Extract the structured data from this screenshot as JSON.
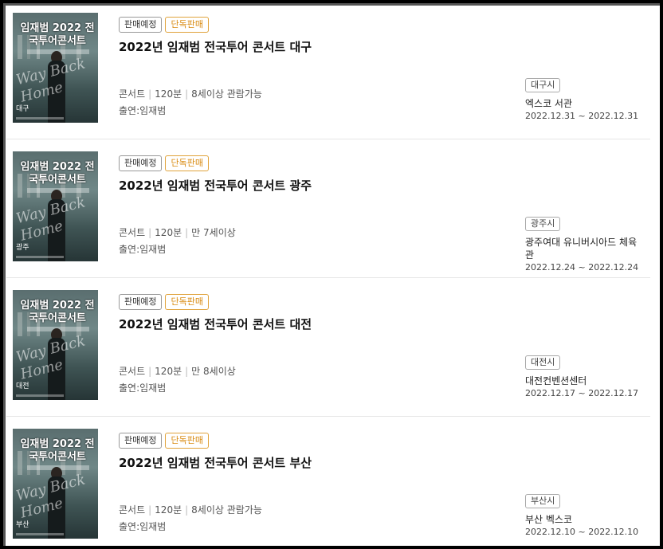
{
  "items": [
    {
      "badge1": "판매예정",
      "badge2": "단독판매",
      "title": "2022년 임재범 전국투어 콘서트 대구",
      "genre": "콘서트",
      "runtime": "120분",
      "age": "8세이상 관람가능",
      "cast": "출연:임재범",
      "region": "대구시",
      "venue": "엑스코 서관",
      "dates": "2022.12.31 ~ 2022.12.31",
      "poster_title": "임재범 2022 전국투어콘서트",
      "poster_script": "Way Back Home",
      "poster_city": "대구"
    },
    {
      "badge1": "판매예정",
      "badge2": "단독판매",
      "title": "2022년 임재범 전국투어 콘서트 광주",
      "genre": "콘서트",
      "runtime": "120분",
      "age": "만 7세이상",
      "cast": "출연:임재범",
      "region": "광주시",
      "venue": "광주여대 유니버시아드 체육관",
      "dates": "2022.12.24 ~ 2022.12.24",
      "poster_title": "임재범 2022 전국투어콘서트",
      "poster_script": "Way Back Home",
      "poster_city": "광주"
    },
    {
      "badge1": "판매예정",
      "badge2": "단독판매",
      "title": "2022년 임재범 전국투어 콘서트 대전",
      "genre": "콘서트",
      "runtime": "120분",
      "age": "만 8세이상",
      "cast": "출연:임재범",
      "region": "대전시",
      "venue": "대전컨벤션센터",
      "dates": "2022.12.17 ~ 2022.12.17",
      "poster_title": "임재범 2022 전국투어콘서트",
      "poster_script": "Way Back Home",
      "poster_city": "대전"
    },
    {
      "badge1": "판매예정",
      "badge2": "단독판매",
      "title": "2022년 임재범 전국투어 콘서트 부산",
      "genre": "콘서트",
      "runtime": "120분",
      "age": "8세이상 관람가능",
      "cast": "출연:임재범",
      "region": "부산시",
      "venue": "부산 벡스코",
      "dates": "2022.12.10 ~ 2022.12.10",
      "poster_title": "임재범 2022 전국투어콘서트",
      "poster_script": "Way Back Home",
      "poster_city": "부산"
    }
  ]
}
